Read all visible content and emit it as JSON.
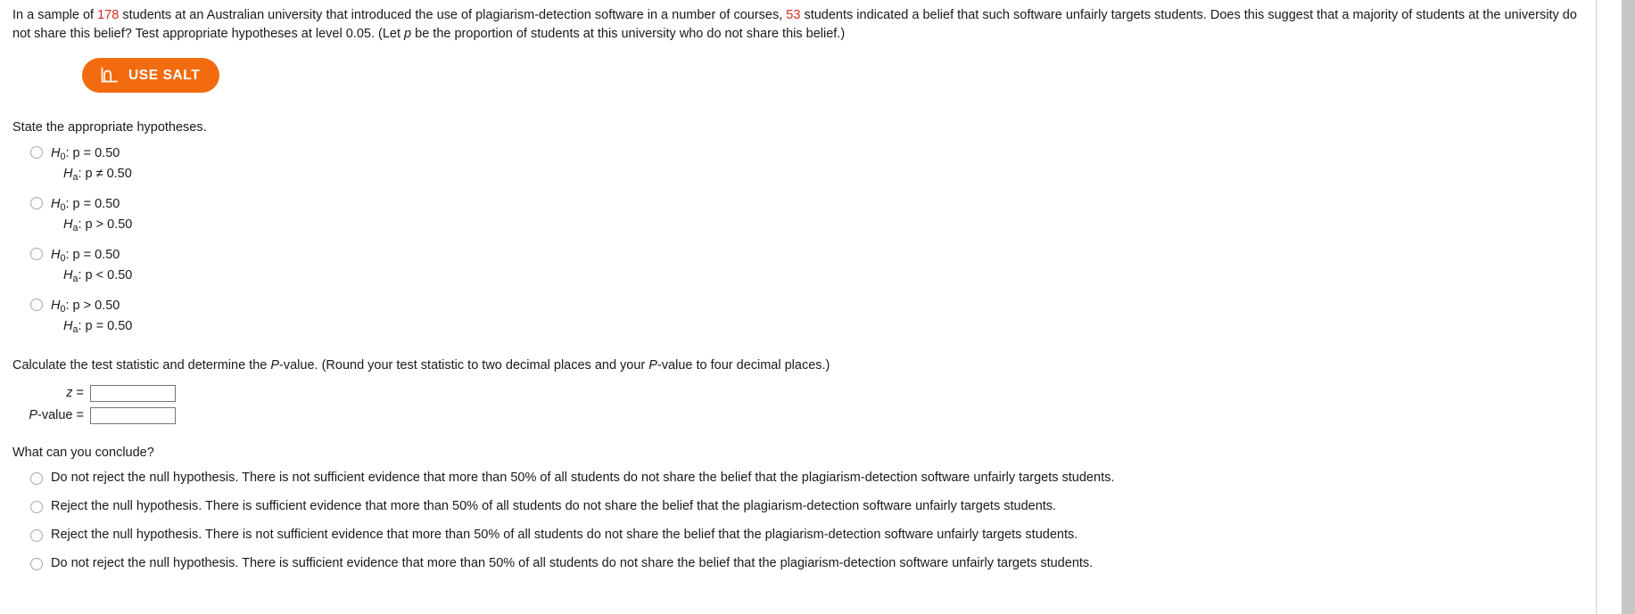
{
  "problem": {
    "text_part1": "In a sample of ",
    "sample_size": "178",
    "text_part2": " students at an Australian university that introduced the use of plagiarism-detection software in a number of courses, ",
    "count": "53",
    "text_part3": " students indicated a belief that such software unfairly targets students. Does this suggest that a majority of students at the university do not share this belief? Test appropriate hypotheses at level 0.05. (Let ",
    "p_symbol": "p",
    "text_part4": " be the proportion of students at this university who do not share this belief.)"
  },
  "salt_button": {
    "label": "USE SALT",
    "icon": "distribution-curve-icon",
    "background_color": "#f26b0f",
    "text_color": "#ffffff"
  },
  "hypotheses_section": {
    "prompt": "State the appropriate hypotheses.",
    "options": [
      {
        "null_label": "H",
        "null_sub": "0",
        "null_rest": ": p = 0.50",
        "alt_label": "H",
        "alt_sub": "a",
        "alt_rest": ": p ≠ 0.50"
      },
      {
        "null_label": "H",
        "null_sub": "0",
        "null_rest": ": p = 0.50",
        "alt_label": "H",
        "alt_sub": "a",
        "alt_rest": ": p > 0.50"
      },
      {
        "null_label": "H",
        "null_sub": "0",
        "null_rest": ": p = 0.50",
        "alt_label": "H",
        "alt_sub": "a",
        "alt_rest": ": p < 0.50"
      },
      {
        "null_label": "H",
        "null_sub": "0",
        "null_rest": ": p > 0.50",
        "alt_label": "H",
        "alt_sub": "a",
        "alt_rest": ": p = 0.50"
      }
    ]
  },
  "statistic_section": {
    "prompt_part1": "Calculate the test statistic and determine the ",
    "prompt_pvalue1": "P",
    "prompt_part2": "-value. (Round your test statistic to two decimal places and your ",
    "prompt_pvalue2": "P",
    "prompt_part3": "-value to four decimal places.)",
    "z_label_italic": "z",
    "z_label_eq": " =",
    "z_value": "",
    "pvalue_label_italic": "P",
    "pvalue_label_rest": "-value  =",
    "pvalue_value": ""
  },
  "conclusion_section": {
    "prompt": "What can you conclude?",
    "options": [
      "Do not reject the null hypothesis. There is not sufficient evidence that more than 50% of all students do not share the belief that the plagiarism-detection software unfairly targets students.",
      "Reject the null hypothesis. There is sufficient evidence that more than 50% of all students do not share the belief that the plagiarism-detection software unfairly targets students.",
      "Reject the null hypothesis. There is not sufficient evidence that more than 50% of all students do not share the belief that the plagiarism-detection software unfairly targets students.",
      "Do not reject the null hypothesis. There is sufficient evidence that more than 50% of all students do not share the belief that the plagiarism-detection software unfairly targets students."
    ]
  }
}
